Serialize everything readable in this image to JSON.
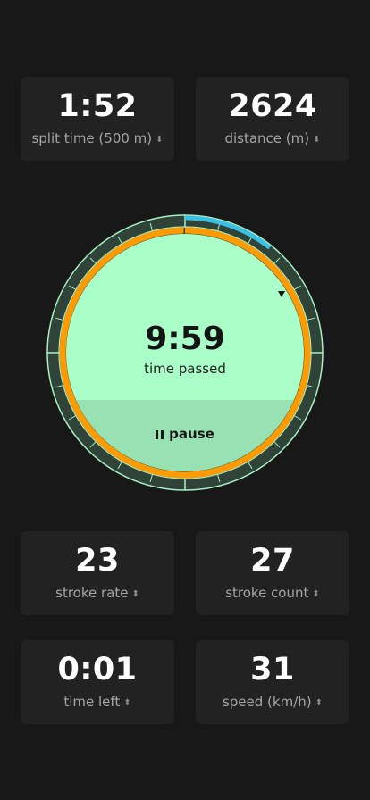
{
  "metrics": {
    "split_time": {
      "value": "1:52",
      "label": "split time (500 m)"
    },
    "distance": {
      "value": "2624",
      "label": "distance (m)"
    },
    "stroke_rate": {
      "value": "23",
      "label": "stroke rate"
    },
    "stroke_count": {
      "value": "27",
      "label": "stroke count"
    },
    "time_left": {
      "value": "0:01",
      "label": "time left"
    },
    "speed": {
      "value": "31",
      "label": "speed (km/h)"
    }
  },
  "dial": {
    "time_value": "9:59",
    "time_label": "time passed",
    "pause_label": "pause",
    "progress_fraction": 0.9983,
    "pace_fraction": 0.108
  },
  "icons": {
    "sort": "sort-updown-icon",
    "pause": "pause-icon",
    "marker": "triangle-marker-icon"
  },
  "colors": {
    "background": "#181818",
    "tile": "#222222",
    "dial_face": "#aaffc9",
    "dial_lower": "#98e1b2",
    "bezel": "#2f4338",
    "progress": "#ff9a00",
    "pace": "#3bc0e4"
  }
}
